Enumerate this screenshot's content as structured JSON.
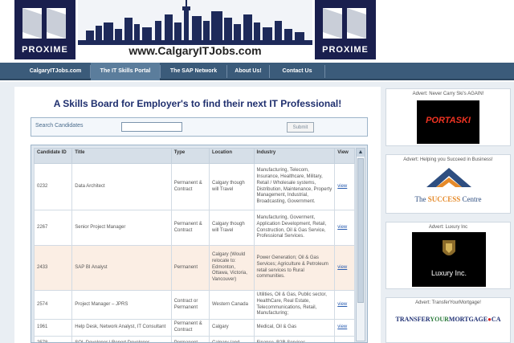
{
  "header": {
    "logo_text": "PROXIME",
    "site_url": "www.CalgaryITJobs.com"
  },
  "nav": {
    "items": [
      {
        "label": "CalgaryITJobs.com",
        "active": false
      },
      {
        "label": "The IT Skills Portal",
        "active": true
      },
      {
        "label": "The SAP Network",
        "active": false
      },
      {
        "label": "About Us!",
        "active": false
      },
      {
        "label": "Contact Us",
        "active": false
      }
    ]
  },
  "main": {
    "headline": "A Skills Board for Employer's to find their next IT Professional!",
    "search": {
      "label": "Search Candidates",
      "value": "",
      "button_label": "Submit"
    },
    "table": {
      "headers": [
        "Candidate ID",
        "Title",
        "Type",
        "Location",
        "Industry",
        "View"
      ],
      "rows": [
        {
          "id": "0232",
          "title": "Data Architect",
          "type": "Permanent & Contract",
          "location": "Calgary though will Travel",
          "industry": "Manufacturing, Telecom, Insurance, Healthcare, Military, Retail / Wholesale systems, Distribution, Maintenance, Property Management, Industrial, Broadcasting, Government.",
          "view": "view",
          "highlight": false
        },
        {
          "id": "2267",
          "title": "Senior Project Manager",
          "type": "Permanent & Contract",
          "location": "Calgary though will Travel",
          "industry": "Manufacturing, Goverment, Application Development, Retail, Construction, Oil & Gas Service, Professional Services.",
          "view": "view",
          "highlight": false
        },
        {
          "id": "2433",
          "title": "SAP BI Analyst",
          "type": "Permanent",
          "location": "Calgary (Would relocate to: Edmonton, Ottawa, Victoria, Vancouver)",
          "industry": "Power Generation; Oil & Gas Services; Agriculture & Petroleum retail services to Rural communities.",
          "view": "view",
          "highlight": true
        },
        {
          "id": "2574",
          "title": "Project Manager – JPRS",
          "type": "Contract or Permanent",
          "location": "Western Canada",
          "industry": "Utilities, Oil & Gas, Public sector, HealthCare, Real Estate, Telecommunications, Retail, Manufacturing;",
          "view": "view",
          "highlight": false
        },
        {
          "id": "1961",
          "title": "Help Desk, Network Analyst, IT Consultant",
          "type": "Permanent & Contract",
          "location": "Calgary",
          "industry": "Medical, Oil & Gas",
          "view": "view",
          "highlight": false
        },
        {
          "id": "2578",
          "title": "SQL Developer | Report Developer",
          "type": "Permanent",
          "location": "Calgary (and",
          "industry": "Finance, B2B Services",
          "view": "",
          "highlight": false
        }
      ]
    }
  },
  "ads": [
    {
      "title": "Advert: Never Carry Ski's AGAIN!",
      "brand": "PORTASKI"
    },
    {
      "title": "Advert: Helping you Succeed in Business!",
      "brand_pre": "The ",
      "brand_main": "SUCCESS",
      "brand_post": " Centre"
    },
    {
      "title": "Advert: Luxury Inc",
      "brand": "Luxury Inc."
    },
    {
      "title": "Advert: TransferYourMortgage!",
      "brand_a": "TRANSFER",
      "brand_b": "YOUR",
      "brand_c": "MORTGAGE",
      "brand_d": "●",
      "brand_e": "CA"
    }
  ],
  "colors": {
    "nav_bg": "#3b5b7a",
    "headline": "#1f2f6e",
    "logo_bg": "#1a1f4e",
    "row_highlight": "#fbeee4",
    "link": "#2a5db0"
  }
}
